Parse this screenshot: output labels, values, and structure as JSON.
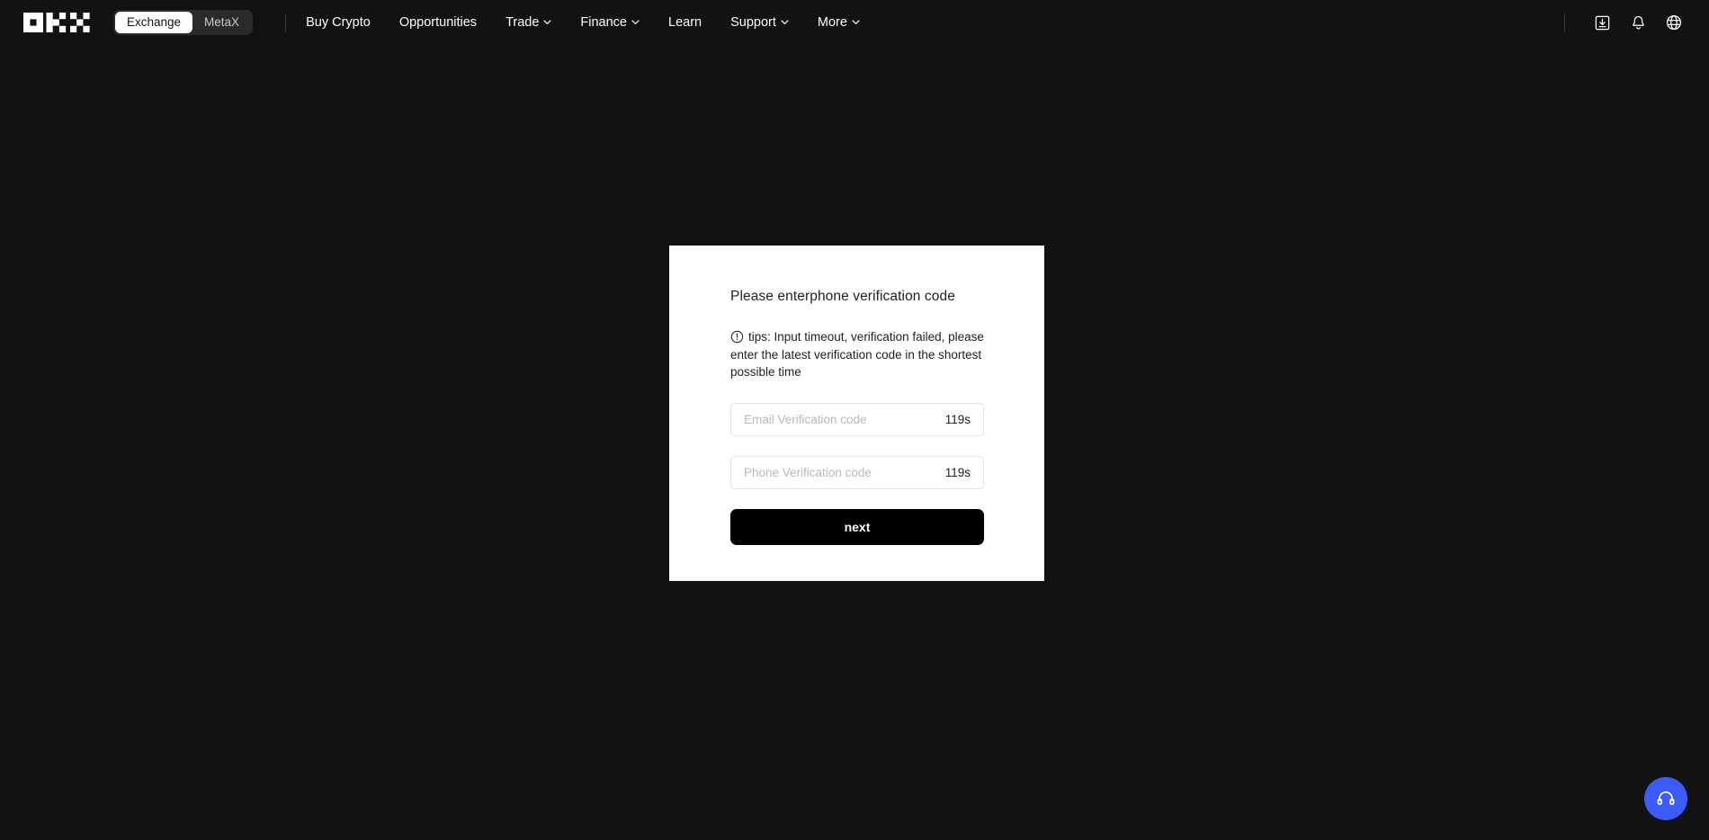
{
  "header": {
    "logo_alt": "okx-logo",
    "product_toggle": {
      "active": "Exchange",
      "options": [
        {
          "label": "Exchange",
          "active": true
        },
        {
          "label": "MetaX",
          "active": false
        }
      ]
    },
    "nav": [
      {
        "label": "Buy Crypto",
        "has_caret": false
      },
      {
        "label": "Opportunities",
        "has_caret": false
      },
      {
        "label": "Trade",
        "has_caret": true
      },
      {
        "label": "Finance",
        "has_caret": true
      },
      {
        "label": "Learn",
        "has_caret": false
      },
      {
        "label": "Support",
        "has_caret": true
      },
      {
        "label": "More",
        "has_caret": true
      }
    ],
    "actions": [
      {
        "icon": "download-icon"
      },
      {
        "icon": "bell-icon"
      },
      {
        "icon": "globe-icon"
      }
    ]
  },
  "card": {
    "title": "Please enterphone verification code",
    "tips_icon": "exclamation-circle-icon",
    "tips_text": "tips: Input timeout, verification failed, please enter the latest verification code in the shortest possible time",
    "fields": [
      {
        "name": "email-verification-code",
        "placeholder": "Email Verification code",
        "value": "",
        "countdown": "119s"
      },
      {
        "name": "phone-verification-code",
        "placeholder": "Phone Verification code",
        "value": "",
        "countdown": "119s"
      }
    ],
    "submit_label": "next"
  },
  "support_fab": {
    "icon": "headset-icon",
    "color": "#3b5bfd"
  },
  "colors": {
    "page_background": "#121212",
    "card_background": "#ffffff",
    "button_background": "#000000",
    "accent_blue": "#3b5bfd",
    "input_border": "#e3e3e3",
    "placeholder": "#b9b9b9"
  }
}
